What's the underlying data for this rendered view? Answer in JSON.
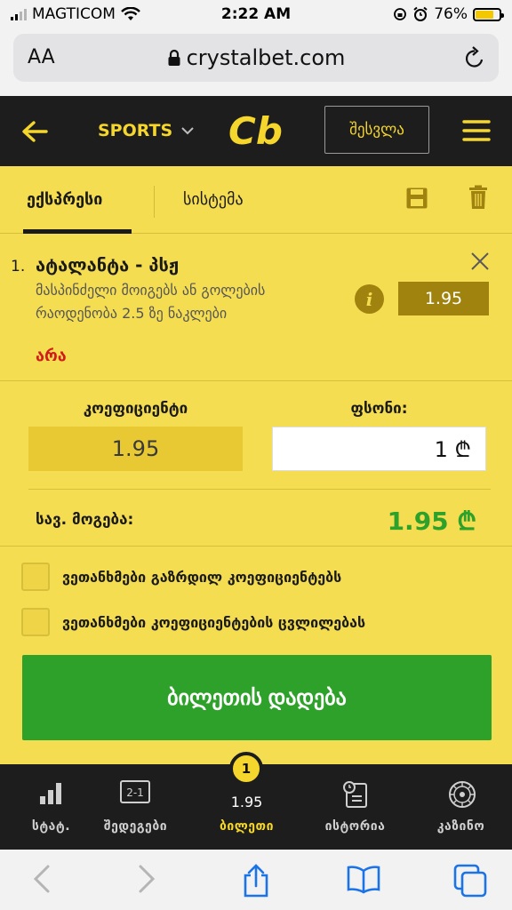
{
  "status_bar": {
    "carrier": "MAGTICOM",
    "time": "2:22 AM",
    "battery": "76%"
  },
  "browser": {
    "text_size_label": "AA",
    "url": "crystalbet.com"
  },
  "header": {
    "sports_label": "SPORTS",
    "logo_text": "Cb",
    "login_label": "შესვლა"
  },
  "tabs": {
    "express": "ექსპრესი",
    "system": "სისტემა"
  },
  "bet": {
    "number": "1.",
    "match": "ატალანტა - პსჟ",
    "market": "მასპინძელი მოიგებს ან გოლების რაოდენობა 2.5 ზე ნაკლები",
    "pick": "არა",
    "odd": "1.95"
  },
  "slip": {
    "coef_label": "კოეფიციენტი",
    "stake_label": "ფსონი:",
    "coef_value": "1.95",
    "stake_value": "1 ₾",
    "win_label": "სავ. მოგება:",
    "win_value": "1.95 ₾"
  },
  "options": {
    "accept_higher": "ვეთანხმები გაზრდილ კოეფიციენტებს",
    "accept_changes": "ვეთანხმები კოეფიციენტების ცვლილებას"
  },
  "place_bet_label": "ბილეთის დადება",
  "bottom_nav": {
    "stats": "სტატ.",
    "results": "შედეგები",
    "results_icon_text": "2-1",
    "ticket": "ბილეთი",
    "ticket_count": "1",
    "ticket_total": "1.95",
    "history": "ისტორია",
    "casino": "კაზინო"
  },
  "colors": {
    "brand_yellow": "#f5dd52",
    "dark": "#1d1d1d",
    "green": "#2ea12a",
    "red": "#d01c1c",
    "olive": "#a0820e"
  }
}
